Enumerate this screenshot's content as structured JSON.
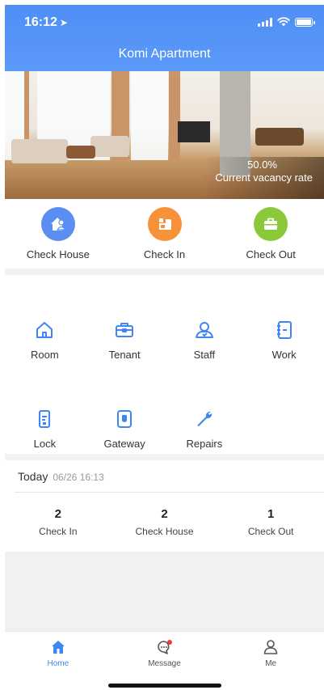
{
  "status_bar": {
    "time": "16:12",
    "location_glyph": "➤"
  },
  "header": {
    "title": "Komi Apartment"
  },
  "hero": {
    "vacancy_value": "50.0%",
    "vacancy_label": "Current vacancy rate"
  },
  "quick_actions": [
    {
      "label": "Check House",
      "icon": "house-person-icon",
      "color": "#5a8ef3"
    },
    {
      "label": "Check In",
      "icon": "bed-icon",
      "color": "#f7923a"
    },
    {
      "label": "Check Out",
      "icon": "briefcase-icon",
      "color": "#8cc93a"
    }
  ],
  "grid_row1": [
    {
      "label": "Room",
      "icon": "room-icon"
    },
    {
      "label": "Tenant",
      "icon": "tenant-icon"
    },
    {
      "label": "Staff",
      "icon": "staff-icon"
    },
    {
      "label": "Work",
      "icon": "work-icon"
    }
  ],
  "grid_row2": [
    {
      "label": "Lock",
      "icon": "lock-icon"
    },
    {
      "label": "Gateway",
      "icon": "gateway-icon"
    },
    {
      "label": "Repairs",
      "icon": "wrench-icon"
    }
  ],
  "today": {
    "title": "Today",
    "datetime": "06/26 16:13",
    "stats": [
      {
        "value": "2",
        "label": "Check In"
      },
      {
        "value": "2",
        "label": "Check House"
      },
      {
        "value": "1",
        "label": "Check Out"
      }
    ]
  },
  "tabbar": {
    "tabs": [
      {
        "label": "Home",
        "icon": "home-icon",
        "active": true
      },
      {
        "label": "Message",
        "icon": "message-icon",
        "active": false,
        "badge_color": "#f0353b"
      },
      {
        "label": "Me",
        "icon": "person-icon",
        "active": false
      }
    ]
  },
  "colors": {
    "accent": "#3f86f2",
    "header": "#4f8ef5",
    "icon_blue": "#3f86f2"
  }
}
